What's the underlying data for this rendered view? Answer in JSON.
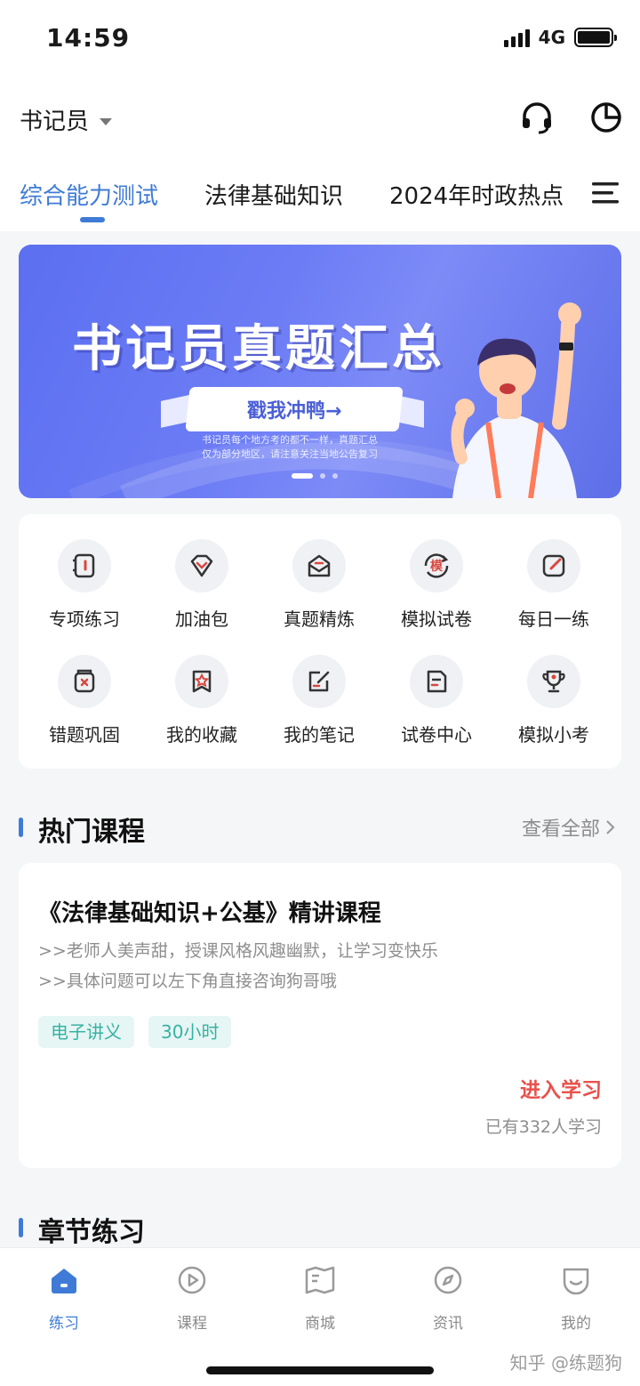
{
  "status_bar": {
    "time": "14:59",
    "network": "4G"
  },
  "header": {
    "exam_name": "书记员"
  },
  "tabs": [
    {
      "label": "综合能力测试",
      "active": true
    },
    {
      "label": "法律基础知识",
      "active": false
    },
    {
      "label": "2024年时政热点",
      "active": false
    }
  ],
  "banner": {
    "title": "书记员真题汇总",
    "button": "戳我冲鸭→",
    "note": "书记员每个地方考的都不一样，真题汇总仅为部分地区，请注意关注当地公告复习"
  },
  "features": [
    {
      "label": "专项练习",
      "icon": "notebook-icon"
    },
    {
      "label": "加油包",
      "icon": "gem-icon"
    },
    {
      "label": "真题精炼",
      "icon": "envelope-icon"
    },
    {
      "label": "模拟试卷",
      "icon": "mock-exam-icon",
      "glyph": "模"
    },
    {
      "label": "每日一练",
      "icon": "edit-icon"
    },
    {
      "label": "错题巩固",
      "icon": "wrong-question-icon"
    },
    {
      "label": "我的收藏",
      "icon": "star-bookmark-icon"
    },
    {
      "label": "我的笔记",
      "icon": "note-edit-icon"
    },
    {
      "label": "试卷中心",
      "icon": "paper-icon"
    },
    {
      "label": "模拟小考",
      "icon": "trophy-icon"
    }
  ],
  "hot_courses": {
    "title": "热门课程",
    "see_all": "查看全部",
    "course": {
      "title": "《法律基础知识+公基》精讲课程",
      "desc_lines": [
        ">>老师人美声甜，授课风格风趣幽默，让学习变快乐",
        ">>具体问题可以左下角直接咨询狗哥哦"
      ],
      "tags": [
        "电子讲义",
        "30小时"
      ],
      "enter": "进入学习",
      "learners": "已有332人学习"
    }
  },
  "chapter_practice": {
    "title": "章节练习"
  },
  "tabbar": [
    {
      "label": "练习",
      "icon": "home-icon",
      "active": true
    },
    {
      "label": "课程",
      "icon": "play-icon",
      "active": false
    },
    {
      "label": "商城",
      "icon": "book-open-icon",
      "active": false
    },
    {
      "label": "资讯",
      "icon": "compass-icon",
      "active": false
    },
    {
      "label": "我的",
      "icon": "profile-icon",
      "active": false
    }
  ],
  "watermark": "知乎 @练题狗",
  "colors": {
    "accent": "#3f7bd6",
    "red": "#e9514c",
    "tag": "#37b2a2",
    "icon_red": "#d9473f"
  }
}
